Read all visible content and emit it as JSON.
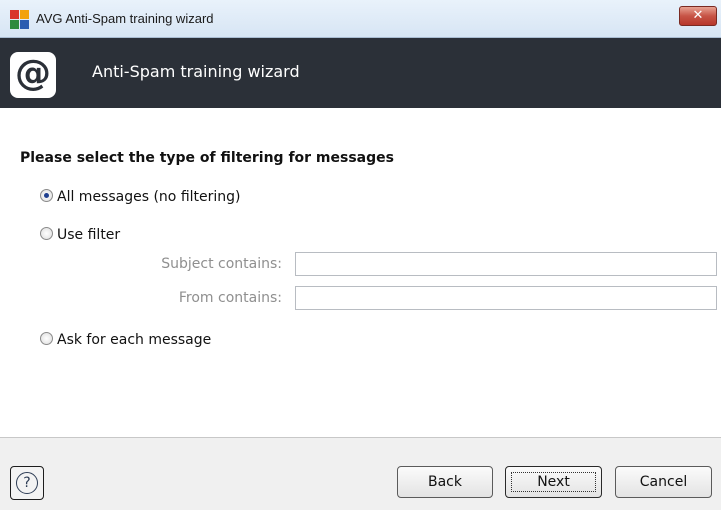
{
  "window": {
    "title": "AVG Anti-Spam training wizard",
    "close_glyph": "✕",
    "app_icon": "avg-logo-icon"
  },
  "banner": {
    "icon": "at-sign-icon",
    "icon_glyph": "@",
    "title": "Anti-Spam training wizard"
  },
  "content": {
    "heading": "Please select the type of filtering for messages",
    "options": [
      {
        "label": "All messages (no filtering)",
        "checked": true
      },
      {
        "label": "Use filter",
        "checked": false
      },
      {
        "label": "Ask for each message",
        "checked": false
      }
    ],
    "filter": {
      "subject_label": "Subject contains:",
      "subject_value": "",
      "from_label": "From contains:",
      "from_value": ""
    }
  },
  "footer": {
    "help_icon": "help-icon",
    "help_glyph": "?",
    "back_label": "Back",
    "next_label": "Next",
    "cancel_label": "Cancel"
  },
  "colors": {
    "banner_bg": "#2b3038",
    "close_red": "#c75446"
  }
}
